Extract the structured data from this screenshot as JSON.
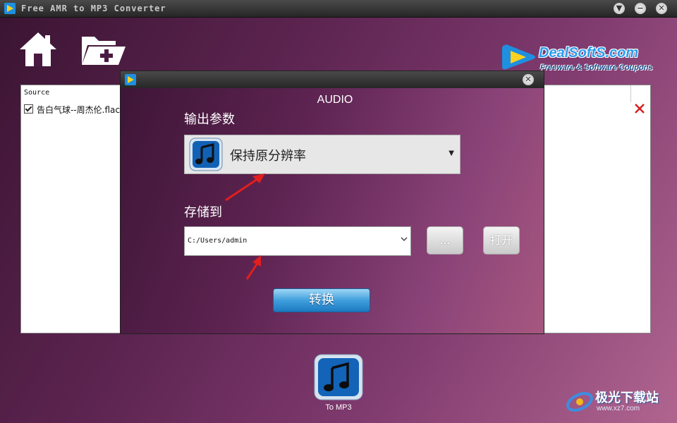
{
  "window": {
    "title": "Free AMR to MP3 Converter"
  },
  "toolbar": {
    "home_icon": "home-icon",
    "add_folder_icon": "add-folder-icon"
  },
  "logo": {
    "brand": "DealSoftS.com",
    "tagline": "Freeware & Software Coupons"
  },
  "source_list": {
    "header": "Source",
    "items": [
      {
        "name": "告白气球--周杰伦.flac",
        "checked": true
      }
    ]
  },
  "dialog": {
    "heading": "AUDIO",
    "output_params_label": "输出参数",
    "format_value": "保持原分辨率",
    "save_to_label": "存储到",
    "path_value": "C:/Users/admin",
    "browse_label": "...",
    "open_label": "打开",
    "convert_label": "转换"
  },
  "bottom": {
    "to_mp3_label": "To MP3"
  },
  "watermark": {
    "text": "极光下载站",
    "url": "www.xz7.com"
  },
  "colors": {
    "accent_blue": "#2a9cf0",
    "background": "#6a2b5d",
    "delete_red": "#d42020"
  }
}
